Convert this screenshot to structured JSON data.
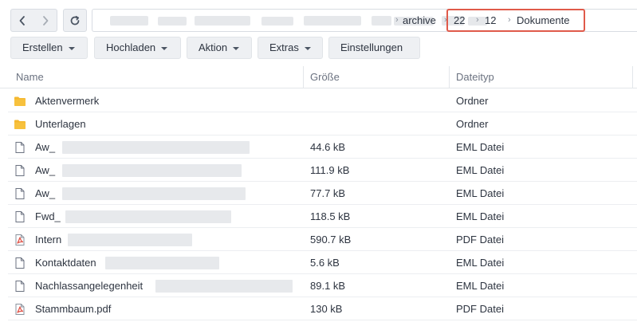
{
  "nav": {
    "back_icon": "chevron-left-icon",
    "forward_icon": "chevron-right-icon",
    "refresh_icon": "refresh-icon"
  },
  "path": {
    "crumbs": [
      "archive",
      "22",
      "12",
      "Dokumente"
    ],
    "separator": "›",
    "highlight_color": "#e05a4a"
  },
  "toolbar": {
    "buttons": [
      {
        "label": "Erstellen",
        "dropdown": true
      },
      {
        "label": "Hochladen",
        "dropdown": true
      },
      {
        "label": "Aktion",
        "dropdown": true
      },
      {
        "label": "Extras",
        "dropdown": true
      },
      {
        "label": "Einstellungen",
        "dropdown": false
      }
    ]
  },
  "table": {
    "columns": [
      "Name",
      "Größe",
      "Dateityp"
    ],
    "rows": [
      {
        "name": "Aktenvermerk",
        "size": "",
        "type": "Ordner",
        "icon": "folder-icon"
      },
      {
        "name": "Unterlagen",
        "size": "",
        "type": "Ordner",
        "icon": "folder-icon"
      },
      {
        "name": "Aw_",
        "size": "44.6 kB",
        "type": "EML Datei",
        "icon": "file-icon"
      },
      {
        "name": "Aw_",
        "size": "111.9 kB",
        "type": "EML Datei",
        "icon": "file-icon"
      },
      {
        "name": "Aw_",
        "size": "77.7 kB",
        "type": "EML Datei",
        "icon": "file-icon"
      },
      {
        "name": "Fwd_",
        "size": "118.5 kB",
        "type": "EML Datei",
        "icon": "file-icon"
      },
      {
        "name": "Intern",
        "size": "590.7 kB",
        "type": "PDF Datei",
        "icon": "pdf-icon"
      },
      {
        "name": "Kontaktdaten",
        "size": "5.6 kB",
        "type": "EML Datei",
        "icon": "file-icon"
      },
      {
        "name": "Nachlassangelegenheit",
        "size": "89.1 kB",
        "type": "EML Datei",
        "icon": "file-icon"
      },
      {
        "name": "Stammbaum.pdf",
        "size": "130 kB",
        "type": "PDF Datei",
        "icon": "pdf-icon"
      }
    ]
  },
  "colors": {
    "folder": "#f5b82e",
    "pdf": "#e2574c",
    "button_bg": "#eef0f3"
  }
}
